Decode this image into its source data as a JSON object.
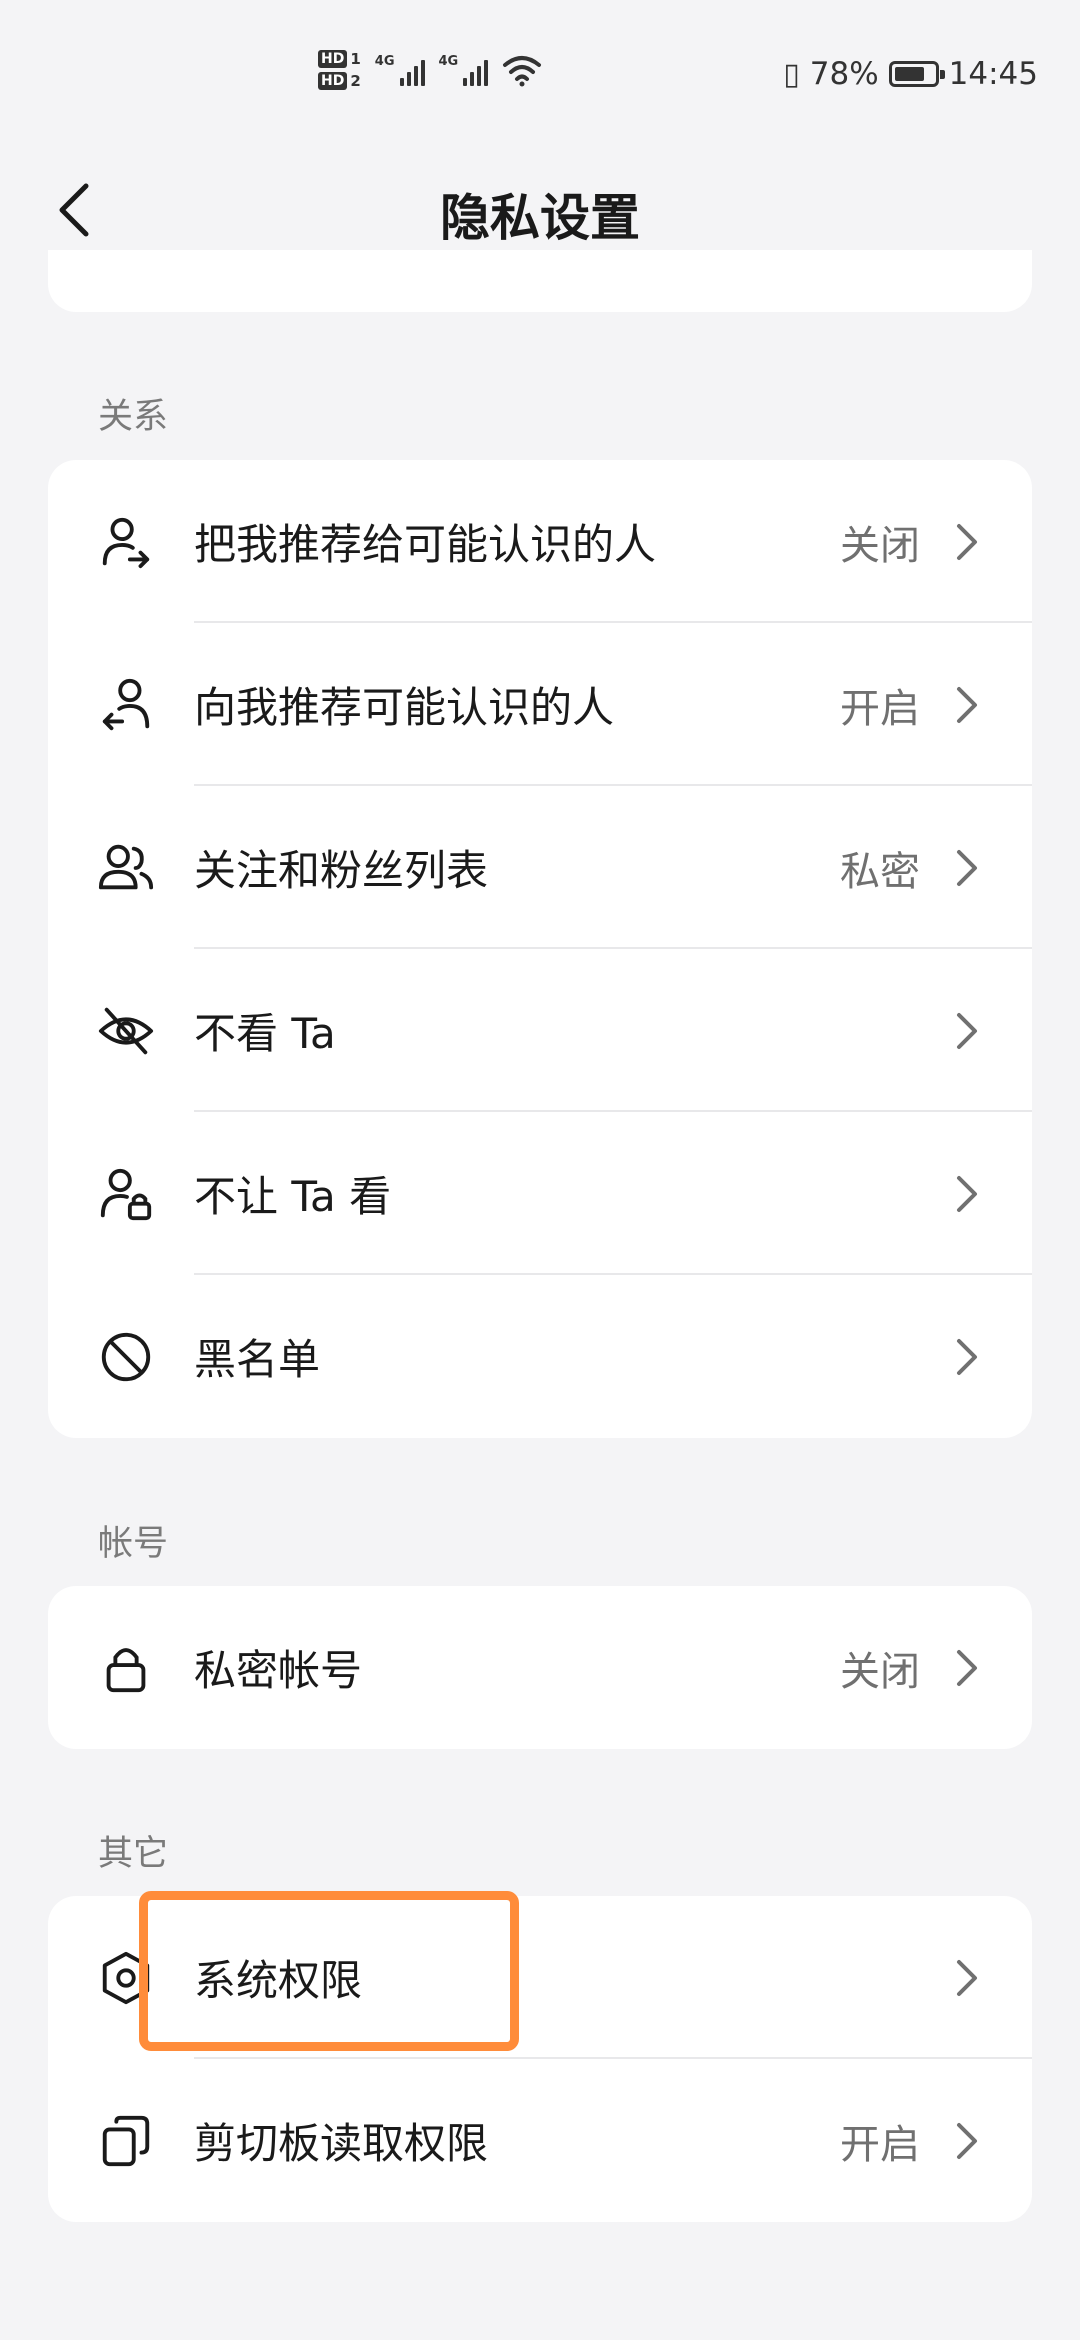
{
  "status_bar": {
    "hd1": "HD",
    "hd1_num": "1",
    "hd2": "HD",
    "hd2_num": "2",
    "signal1_label": "4G",
    "signal2_label": "4G",
    "battery_percent": "78%",
    "battery_level": 0.78,
    "time": "14:45"
  },
  "header": {
    "title": "隐私设置",
    "back_icon": "chevron-left-icon"
  },
  "sections": {
    "relations": {
      "label": "关系",
      "items": [
        {
          "label": "把我推荐给可能认识的人",
          "value": "关闭",
          "icon": "person-share-icon"
        },
        {
          "label": "向我推荐可能认识的人",
          "value": "开启",
          "icon": "person-receive-icon"
        },
        {
          "label": "关注和粉丝列表",
          "value": "私密",
          "icon": "people-icon"
        },
        {
          "label": "不看 Ta",
          "value": "",
          "icon": "eye-off-icon"
        },
        {
          "label": "不让 Ta 看",
          "value": "",
          "icon": "person-lock-icon"
        },
        {
          "label": "黑名单",
          "value": "",
          "icon": "block-icon"
        }
      ]
    },
    "account": {
      "label": "帐号",
      "items": [
        {
          "label": "私密帐号",
          "value": "关闭",
          "icon": "lock-icon"
        }
      ]
    },
    "other": {
      "label": "其它",
      "items": [
        {
          "label": "系统权限",
          "value": "",
          "icon": "hexagon-settings-icon"
        },
        {
          "label": "剪切板读取权限",
          "value": "开启",
          "icon": "clipboard-copy-icon"
        }
      ]
    }
  },
  "colors": {
    "background": "#f4f4f6",
    "card": "#ffffff",
    "highlight": "#ff8c3a",
    "secondary_text": "#707070"
  }
}
